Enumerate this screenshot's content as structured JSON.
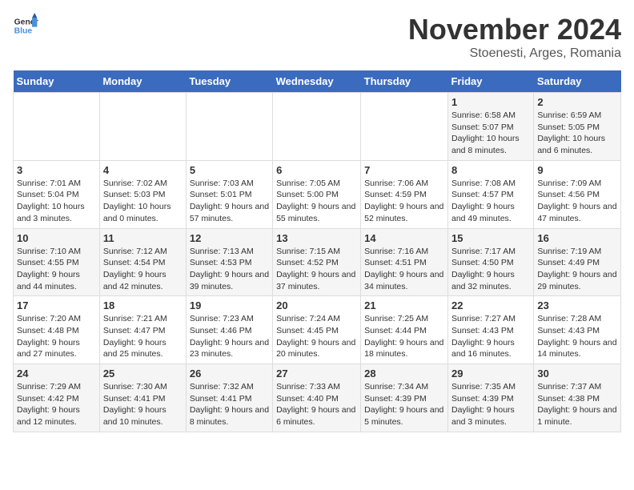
{
  "logo": {
    "line1": "General",
    "line2": "Blue"
  },
  "title": "November 2024",
  "location": "Stoenesti, Arges, Romania",
  "weekdays": [
    "Sunday",
    "Monday",
    "Tuesday",
    "Wednesday",
    "Thursday",
    "Friday",
    "Saturday"
  ],
  "weeks": [
    [
      {
        "day": "",
        "info": ""
      },
      {
        "day": "",
        "info": ""
      },
      {
        "day": "",
        "info": ""
      },
      {
        "day": "",
        "info": ""
      },
      {
        "day": "",
        "info": ""
      },
      {
        "day": "1",
        "info": "Sunrise: 6:58 AM\nSunset: 5:07 PM\nDaylight: 10 hours and 8 minutes."
      },
      {
        "day": "2",
        "info": "Sunrise: 6:59 AM\nSunset: 5:05 PM\nDaylight: 10 hours and 6 minutes."
      }
    ],
    [
      {
        "day": "3",
        "info": "Sunrise: 7:01 AM\nSunset: 5:04 PM\nDaylight: 10 hours and 3 minutes."
      },
      {
        "day": "4",
        "info": "Sunrise: 7:02 AM\nSunset: 5:03 PM\nDaylight: 10 hours and 0 minutes."
      },
      {
        "day": "5",
        "info": "Sunrise: 7:03 AM\nSunset: 5:01 PM\nDaylight: 9 hours and 57 minutes."
      },
      {
        "day": "6",
        "info": "Sunrise: 7:05 AM\nSunset: 5:00 PM\nDaylight: 9 hours and 55 minutes."
      },
      {
        "day": "7",
        "info": "Sunrise: 7:06 AM\nSunset: 4:59 PM\nDaylight: 9 hours and 52 minutes."
      },
      {
        "day": "8",
        "info": "Sunrise: 7:08 AM\nSunset: 4:57 PM\nDaylight: 9 hours and 49 minutes."
      },
      {
        "day": "9",
        "info": "Sunrise: 7:09 AM\nSunset: 4:56 PM\nDaylight: 9 hours and 47 minutes."
      }
    ],
    [
      {
        "day": "10",
        "info": "Sunrise: 7:10 AM\nSunset: 4:55 PM\nDaylight: 9 hours and 44 minutes."
      },
      {
        "day": "11",
        "info": "Sunrise: 7:12 AM\nSunset: 4:54 PM\nDaylight: 9 hours and 42 minutes."
      },
      {
        "day": "12",
        "info": "Sunrise: 7:13 AM\nSunset: 4:53 PM\nDaylight: 9 hours and 39 minutes."
      },
      {
        "day": "13",
        "info": "Sunrise: 7:15 AM\nSunset: 4:52 PM\nDaylight: 9 hours and 37 minutes."
      },
      {
        "day": "14",
        "info": "Sunrise: 7:16 AM\nSunset: 4:51 PM\nDaylight: 9 hours and 34 minutes."
      },
      {
        "day": "15",
        "info": "Sunrise: 7:17 AM\nSunset: 4:50 PM\nDaylight: 9 hours and 32 minutes."
      },
      {
        "day": "16",
        "info": "Sunrise: 7:19 AM\nSunset: 4:49 PM\nDaylight: 9 hours and 29 minutes."
      }
    ],
    [
      {
        "day": "17",
        "info": "Sunrise: 7:20 AM\nSunset: 4:48 PM\nDaylight: 9 hours and 27 minutes."
      },
      {
        "day": "18",
        "info": "Sunrise: 7:21 AM\nSunset: 4:47 PM\nDaylight: 9 hours and 25 minutes."
      },
      {
        "day": "19",
        "info": "Sunrise: 7:23 AM\nSunset: 4:46 PM\nDaylight: 9 hours and 23 minutes."
      },
      {
        "day": "20",
        "info": "Sunrise: 7:24 AM\nSunset: 4:45 PM\nDaylight: 9 hours and 20 minutes."
      },
      {
        "day": "21",
        "info": "Sunrise: 7:25 AM\nSunset: 4:44 PM\nDaylight: 9 hours and 18 minutes."
      },
      {
        "day": "22",
        "info": "Sunrise: 7:27 AM\nSunset: 4:43 PM\nDaylight: 9 hours and 16 minutes."
      },
      {
        "day": "23",
        "info": "Sunrise: 7:28 AM\nSunset: 4:43 PM\nDaylight: 9 hours and 14 minutes."
      }
    ],
    [
      {
        "day": "24",
        "info": "Sunrise: 7:29 AM\nSunset: 4:42 PM\nDaylight: 9 hours and 12 minutes."
      },
      {
        "day": "25",
        "info": "Sunrise: 7:30 AM\nSunset: 4:41 PM\nDaylight: 9 hours and 10 minutes."
      },
      {
        "day": "26",
        "info": "Sunrise: 7:32 AM\nSunset: 4:41 PM\nDaylight: 9 hours and 8 minutes."
      },
      {
        "day": "27",
        "info": "Sunrise: 7:33 AM\nSunset: 4:40 PM\nDaylight: 9 hours and 6 minutes."
      },
      {
        "day": "28",
        "info": "Sunrise: 7:34 AM\nSunset: 4:39 PM\nDaylight: 9 hours and 5 minutes."
      },
      {
        "day": "29",
        "info": "Sunrise: 7:35 AM\nSunset: 4:39 PM\nDaylight: 9 hours and 3 minutes."
      },
      {
        "day": "30",
        "info": "Sunrise: 7:37 AM\nSunset: 4:38 PM\nDaylight: 9 hours and 1 minute."
      }
    ]
  ]
}
